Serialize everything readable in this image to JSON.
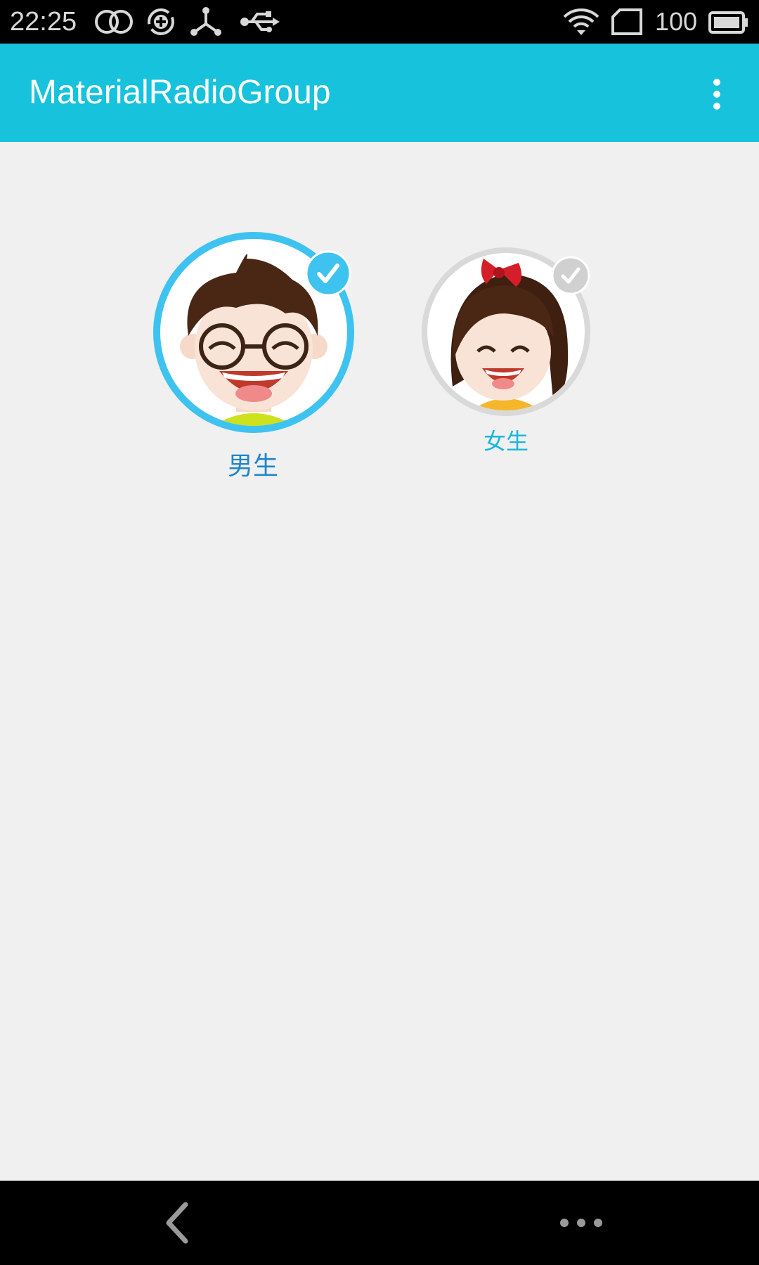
{
  "status_bar": {
    "time": "22:25",
    "battery": "100",
    "icons": [
      "dual-rings-icon",
      "sync-plus-icon",
      "share-node-icon",
      "usb-icon",
      "wifi-icon",
      "sim-card-icon",
      "battery-icon"
    ]
  },
  "app_bar": {
    "title": "MaterialRadioGroup",
    "overflow_icon": "more-vertical-icon"
  },
  "options": [
    {
      "label": "男生",
      "avatar": "boy-avatar",
      "selected": true
    },
    {
      "label": "女生",
      "avatar": "girl-avatar",
      "selected": false
    }
  ],
  "colors": {
    "app_bar": "#17c2dc",
    "selected_ring": "#3ec3f0",
    "unselected_ring": "#d9d9d9",
    "selected_label": "#1f86c9",
    "unselected_label": "#17b8d8",
    "background": "#f0f0f0"
  },
  "nav_bar": {
    "back_icon": "back-chevron-icon",
    "menu_icon": "more-horizontal-icon"
  }
}
